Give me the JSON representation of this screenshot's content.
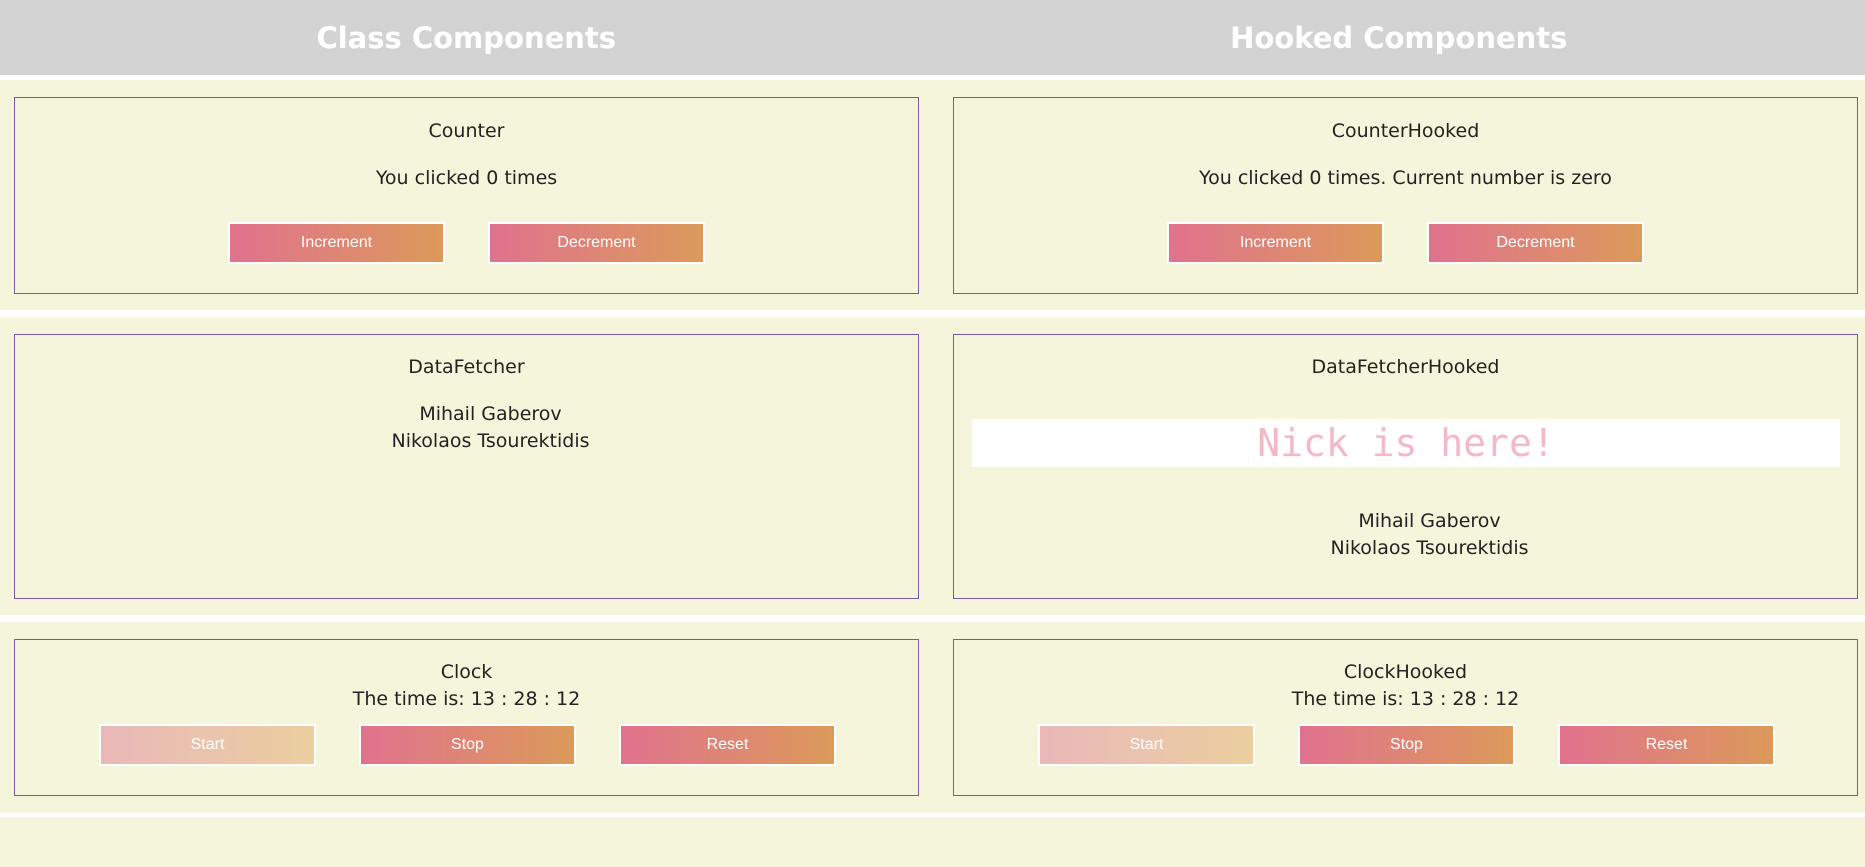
{
  "header": {
    "left_title": "Class Components",
    "right_title": "Hooked Components"
  },
  "counter": {
    "title": "Counter",
    "message": "You clicked 0 times",
    "increment_label": "Increment",
    "decrement_label": "Decrement"
  },
  "counter_hooked": {
    "title": "CounterHooked",
    "message": "You clicked 0 times. Current number is zero",
    "increment_label": "Increment",
    "decrement_label": "Decrement"
  },
  "data_fetcher": {
    "title": "DataFetcher",
    "names": [
      "Mihail Gaberov",
      "Nikolaos Tsourektidis"
    ]
  },
  "data_fetcher_hooked": {
    "title": "DataFetcherHooked",
    "banner": "Nick is here!",
    "names": [
      "Mihail Gaberov",
      "Nikolaos Tsourektidis"
    ]
  },
  "clock": {
    "title": "Clock",
    "time": "The time is: 13 : 28 : 12",
    "start_label": "Start",
    "stop_label": "Stop",
    "reset_label": "Reset"
  },
  "clock_hooked": {
    "title": "ClockHooked",
    "time": "The time is: 13 : 28 : 12",
    "start_label": "Start",
    "stop_label": "Stop",
    "reset_label": "Reset"
  },
  "colors": {
    "header_bg": "#d3d3d3",
    "panel_bg": "#f5f5dc",
    "border": "#7a5aa8",
    "button_gradient_start": "#e0728e",
    "button_gradient_end": "#dc9a5a",
    "banner_text": "#f4b8c6"
  }
}
